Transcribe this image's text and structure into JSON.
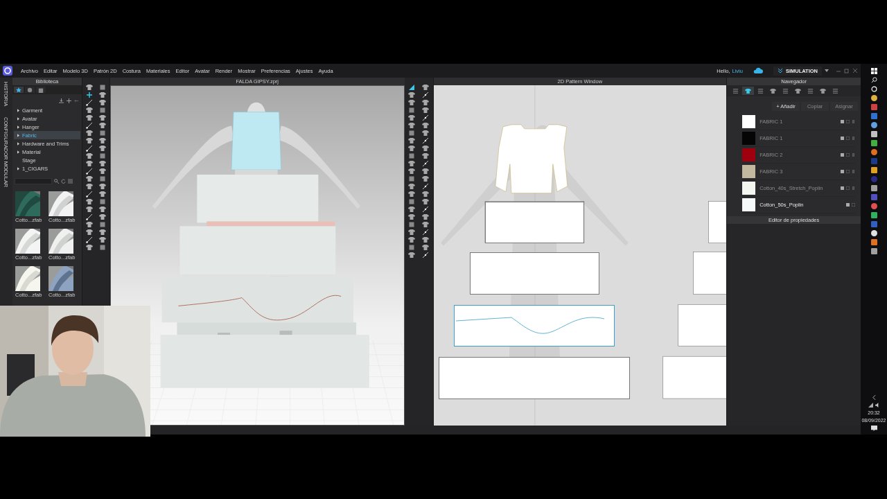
{
  "menu": [
    "Archivo",
    "Editar",
    "Modelo 3D",
    "Patrón 2D",
    "Costura",
    "Materiales",
    "Editor",
    "Avatar",
    "Render",
    "Mostrar",
    "Preferencias",
    "Ajustes",
    "Ayuda"
  ],
  "account": {
    "greeting": "Hello,",
    "user": "Liviu"
  },
  "mode_button": "SIMULATION",
  "side_tabs": [
    "HISTORIA",
    "CONFIGURADOR MODULAR"
  ],
  "library": {
    "title": "Biblioteca",
    "tabs": [
      {
        "selected": true
      },
      {
        "selected": false
      },
      {
        "selected": false
      }
    ],
    "items": [
      {
        "label": "Garment",
        "has_children": true,
        "selected": false
      },
      {
        "label": "Avatar",
        "has_children": true,
        "selected": false
      },
      {
        "label": "Hanger",
        "has_children": true,
        "selected": false
      },
      {
        "label": "Fabric",
        "has_children": true,
        "selected": true
      },
      {
        "label": "Hardware and Trims",
        "has_children": true,
        "selected": false
      },
      {
        "label": "Material",
        "has_children": true,
        "selected": false
      },
      {
        "label": "Stage",
        "has_children": false,
        "selected": false
      },
      {
        "label": "1_CIGARS",
        "has_children": true,
        "selected": false
      }
    ],
    "thumbnails": [
      {
        "kind": "picture",
        "label": "Cotto...zfab"
      },
      {
        "kind": "picture",
        "label": "Cotto...zfab"
      },
      {
        "kind": "picture",
        "label": "Cotto...zfab"
      },
      {
        "kind": "picture",
        "label": "Cotto...zfab"
      },
      {
        "kind": "picture",
        "label": "Cotto...zfab"
      },
      {
        "kind": "picture",
        "label": "Cotto...zfab"
      }
    ]
  },
  "view_3d": {
    "title": "FALDA GIPSY.zprj"
  },
  "view_2d": {
    "title": "2D Pattern Window",
    "pieces": [
      {
        "selected": false
      },
      {
        "selected": false
      },
      {
        "selected": true
      },
      {
        "selected": false
      }
    ]
  },
  "navigator": {
    "title": "Navegador",
    "tabs": [
      {
        "selected": false
      },
      {
        "selected": true
      },
      {
        "selected": false
      },
      {
        "selected": false
      },
      {
        "selected": false
      },
      {
        "selected": false
      },
      {
        "selected": false
      },
      {
        "selected": false
      },
      {
        "selected": false
      }
    ],
    "buttons": [
      {
        "label": "+ Añadir",
        "disabled": false
      },
      {
        "label": "Copiar",
        "disabled": true
      },
      {
        "label": "Asignar",
        "disabled": true
      }
    ],
    "fabrics": [
      {
        "name": "FABRIC 1",
        "color": "#ffffff",
        "selected": false
      },
      {
        "name": "FABRIC 1",
        "color": "#050505",
        "selected": false
      },
      {
        "name": "FABRIC 2",
        "color": "#a0000e",
        "selected": false
      },
      {
        "name": "FABRIC 3",
        "color": "#c2b8a0",
        "selected": false
      },
      {
        "name": "Cotton_40s_Stretch_Poplin",
        "color": "#f4f7f0",
        "selected": false
      },
      {
        "name": "Cotton_50s_Poplin",
        "color": "#f7fafa",
        "selected": true
      }
    ]
  },
  "property_editor": {
    "title": "Editor de propiedades"
  },
  "webcam": {
    "kind": "picture"
  },
  "clock": {
    "time": "20:32",
    "date": "08/09/2022"
  }
}
